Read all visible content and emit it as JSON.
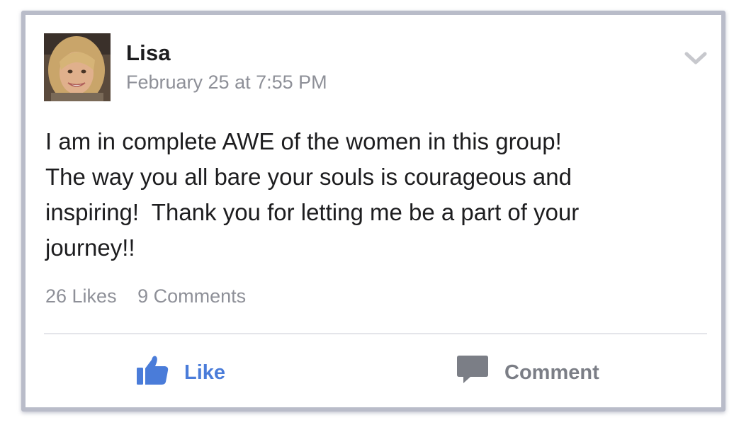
{
  "post": {
    "author": "Lisa",
    "timestamp": "February 25 at 7:55 PM",
    "body_lines": [
      "I am in complete AWE of the women in this group!",
      "The way you all bare your souls is courageous and",
      "inspiring!  Thank you for letting me be a part of your",
      "journey!!"
    ],
    "likes": "26 Likes",
    "comments": "9 Comments"
  },
  "actions": {
    "like_label": "Like",
    "comment_label": "Comment"
  },
  "icons": {
    "options": "chevron-down-icon",
    "like": "thumbs-up-icon",
    "comment": "speech-bubble-icon"
  },
  "colors": {
    "like_blue": "#4a7cd9",
    "comment_gray": "#7b7e86",
    "meta_gray": "#8e9098",
    "frame_border": "#b9bcc9"
  }
}
